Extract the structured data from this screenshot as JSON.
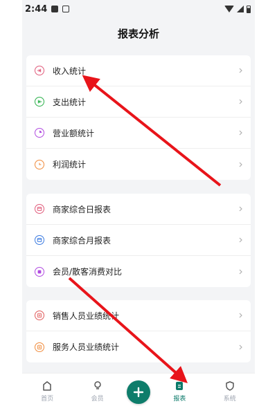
{
  "status_bar": {
    "time": "2:44"
  },
  "header": {
    "title": "报表分析"
  },
  "groups": [
    {
      "items": [
        {
          "label": "收入统计",
          "icon": "login-icon",
          "color": "#e05a7a"
        },
        {
          "label": "支出统计",
          "icon": "logout-icon",
          "color": "#2bb04a"
        },
        {
          "label": "营业额统计",
          "icon": "pie-icon",
          "color": "#b04ae0"
        },
        {
          "label": "利润统计",
          "icon": "clock-icon",
          "color": "#f08a3a"
        }
      ]
    },
    {
      "items": [
        {
          "label": "商家综合日报表",
          "icon": "calendar-icon",
          "color": "#e05a7a"
        },
        {
          "label": "商家综合月报表",
          "icon": "calendar-icon",
          "color": "#3a7ae0"
        },
        {
          "label": "会员/散客消费对比",
          "icon": "card-icon",
          "color": "#b04ae0"
        }
      ]
    },
    {
      "items": [
        {
          "label": "销售人员业绩统计",
          "icon": "edit-icon",
          "color": "#e05a5a"
        },
        {
          "label": "服务人员业绩统计",
          "icon": "edit-icon",
          "color": "#f08a3a"
        }
      ]
    }
  ],
  "nav": {
    "home": "首页",
    "member": "会员",
    "report": "报表",
    "system": "系统"
  },
  "colors": {
    "accent": "#0e7d6b",
    "arrow": "#e8141a"
  }
}
